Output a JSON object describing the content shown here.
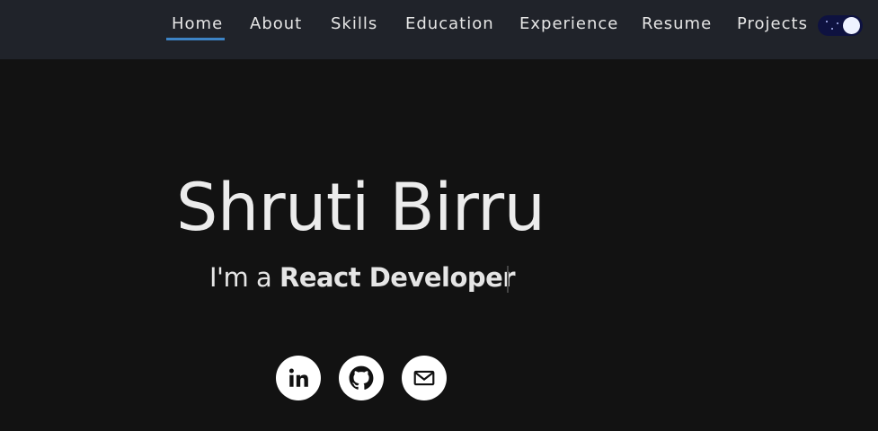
{
  "nav": {
    "items": [
      {
        "label": "Home",
        "active": true
      },
      {
        "label": "About"
      },
      {
        "label": "Skills"
      },
      {
        "label": "Education"
      },
      {
        "label": "Experience"
      },
      {
        "label": "Resume"
      },
      {
        "label": "Projects"
      }
    ],
    "theme_toggle": {
      "mode": "dark",
      "icon": "moon-icon"
    }
  },
  "hero": {
    "name": "Shruti Birru",
    "subtitle_prefix": "I'm a ",
    "subtitle_role": "React Developer"
  },
  "social": [
    {
      "icon": "linkedin-icon"
    },
    {
      "icon": "github-icon"
    },
    {
      "icon": "mail-icon"
    }
  ],
  "colors": {
    "background": "#121212",
    "navbar": "#20232a",
    "accent": "#3d84c6",
    "text": "#ececec",
    "toggle_track": "#0e1240"
  }
}
